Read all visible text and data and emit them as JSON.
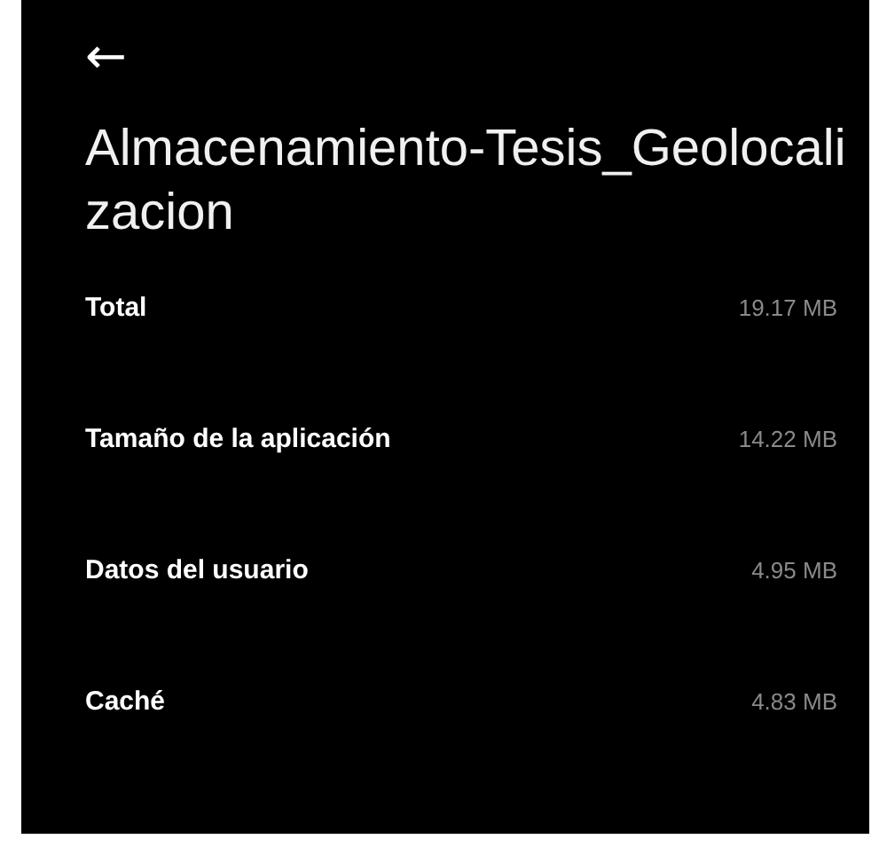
{
  "header": {
    "back": "←",
    "title": "Almacenamiento-Tesis_Geolocalizacion"
  },
  "rows": [
    {
      "label": "Total",
      "value": "19.17 MB"
    },
    {
      "label": "Tamaño de la aplicación",
      "value": "14.22 MB"
    },
    {
      "label": "Datos del usuario",
      "value": "4.95 MB"
    },
    {
      "label": "Caché",
      "value": "4.83 MB"
    }
  ]
}
